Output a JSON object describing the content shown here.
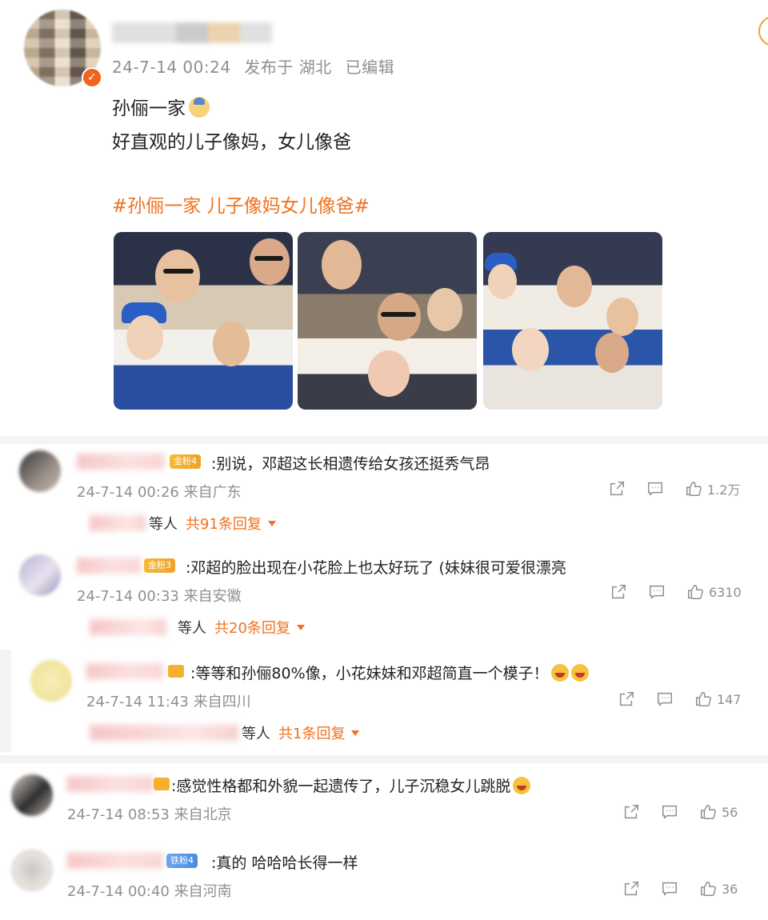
{
  "post": {
    "meta": {
      "date": "24-7-14 00:24",
      "published_from": "发布于 湖北",
      "edited": "已编辑"
    },
    "text_line1": "孙俪一家",
    "text_line2": "好直观的儿子像妈，女儿像爸",
    "hashtag": "#孙俪一家 儿子像妈女儿像爸#",
    "photos": [
      "photo-1",
      "photo-2",
      "photo-3"
    ]
  },
  "comments": [
    {
      "badge": "金粉4",
      "text": ":别说，邓超这长相遗传给女孩还挺秀气昂",
      "meta": "24-7-14 00:26 来自广东",
      "likes": "1.2万",
      "reply_prefix": "等人",
      "reply_count": "共91条回复"
    },
    {
      "badge": "金粉3",
      "text": ":邓超的脸出现在小花脸上也太好玩了 (妹妹很可爱很漂亮",
      "meta": "24-7-14 00:33 来自安徽",
      "likes": "6310",
      "reply_prefix": "等人",
      "reply_count": "共20条回复"
    },
    {
      "text": ":等等和孙俪80%像，小花妹妹和邓超简直一个模子！",
      "meta": "24-7-14 11:43 来自四川",
      "likes": "147",
      "reply_prefix": "等人",
      "reply_count": "共1条回复"
    },
    {
      "text": ":感觉性格都和外貌一起遗传了，儿子沉稳女儿跳脱",
      "meta": "24-7-14 08:53 来自北京",
      "likes": "56"
    },
    {
      "badge": "铁粉4",
      "text": ":真的 哈哈哈长得一样",
      "meta": "24-7-14 00:40 来自河南",
      "likes": "36"
    }
  ],
  "colors": {
    "accent": "#f0711e",
    "meta_gray": "#8f8f8f",
    "gold_badge": "#f5b93a",
    "blue_badge": "#4a8be0"
  },
  "icons": [
    "share-icon",
    "comment-icon",
    "like-icon",
    "verified-icon",
    "crown-icon",
    "laugh-emoji-icon",
    "family-emoji-icon"
  ]
}
